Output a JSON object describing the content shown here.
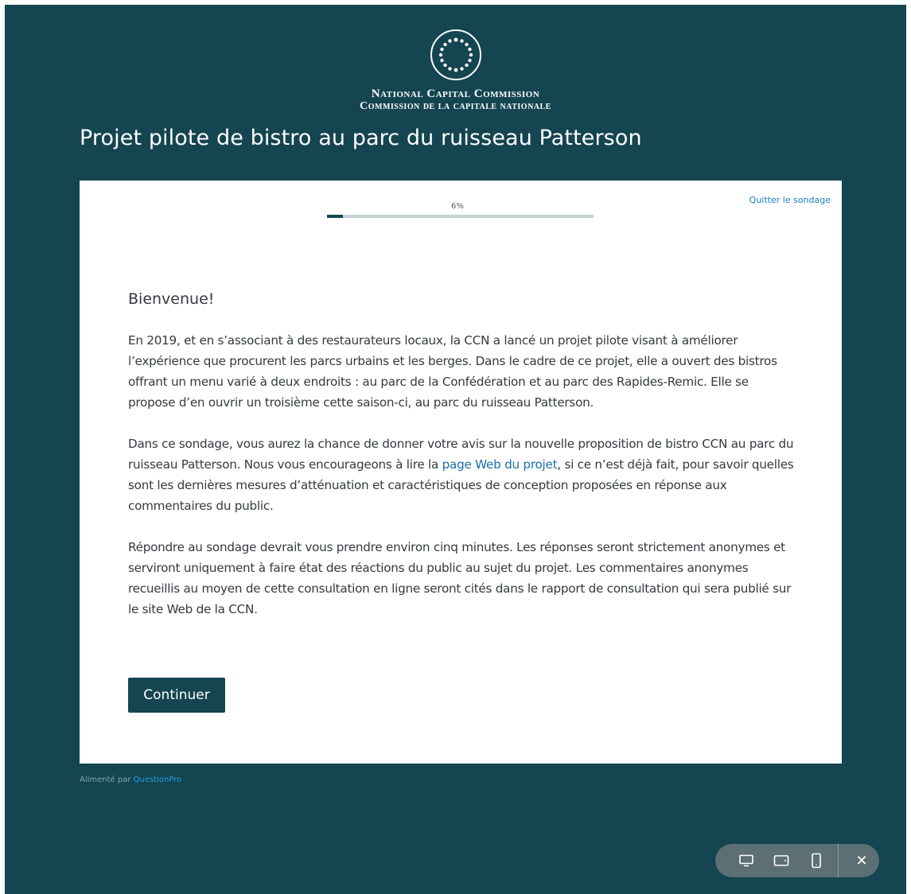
{
  "org": {
    "name_en": "National Capital Commission",
    "name_fr": "Commission de la capitale nationale"
  },
  "page_title": "Projet pilote de bistro au parc du ruisseau Patterson",
  "progress": {
    "label": "6%",
    "percent": 6
  },
  "quit_label": "Quitter le sondage",
  "welcome_heading": "Bienvenue!",
  "paragraphs": {
    "p1": "En 2019, et en s’associant à des restaurateurs locaux, la CCN a lancé un projet pilote visant à améliorer l’expérience que procurent les parcs urbains et les berges. Dans le cadre de ce projet, elle a ouvert des bistros offrant un menu varié à deux endroits : au parc de la Confédération et au parc des Rapides-Remic. Elle se propose d’en ouvrir un troisième cette saison-ci, au parc du ruisseau Patterson.",
    "p2_before": "Dans ce sondage, vous aurez la chance de donner votre avis sur la nouvelle proposition de bistro CCN au parc du ruisseau Patterson. Nous vous encourageons à lire la ",
    "p2_link": "page Web du projet",
    "p2_after": ", si ce n’est déjà fait, pour savoir quelles sont les dernières mesures d’atténuation et caractéristiques de conception proposées en réponse aux commentaires du public.",
    "p3": "Répondre au sondage devrait vous prendre environ cinq minutes. Les réponses seront strictement anonymes et serviront uniquement à faire état des réactions du public au sujet du projet. Les commentaires anonymes recueillis au moyen de cette consultation en ligne seront cités dans le rapport de consultation qui sera publié sur le site Web de la CCN."
  },
  "continue_label": "Continuer",
  "footer": {
    "powered_prefix": "Alimenté par ",
    "powered_brand": "QuestionPro"
  },
  "device_bar": {
    "icons": [
      "desktop-icon",
      "tablet-icon",
      "phone-icon",
      "close-icon"
    ],
    "close_glyph": "✕"
  },
  "colors": {
    "background": "#144551",
    "accent": "#144551",
    "link": "#1a7dc4",
    "brand_link": "#2a9be0"
  }
}
